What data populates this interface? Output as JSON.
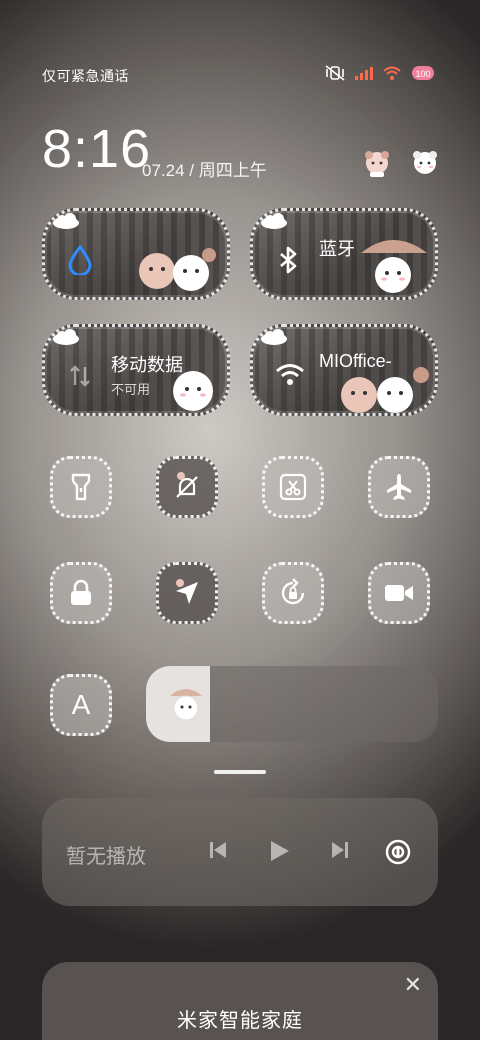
{
  "status_bar": {
    "carrier_text": "仅可紧急通话",
    "battery": "100"
  },
  "header": {
    "time": "8:16",
    "date": "07.24 / 周四上午"
  },
  "tiles": [
    {
      "id": "water",
      "title": "",
      "sub": "",
      "icon": "water-drop-icon",
      "accent": "#2f8cff"
    },
    {
      "id": "bluetooth",
      "title": "蓝牙",
      "sub": "",
      "icon": "bluetooth-icon"
    },
    {
      "id": "mobile-data",
      "title": "移动数据",
      "sub": "不可用",
      "icon": "mobile-data-icon"
    },
    {
      "id": "wifi",
      "title": "MIOffice-",
      "sub": "",
      "icon": "wifi-icon"
    }
  ],
  "toggles_row1": [
    "flashlight-icon",
    "mute-bell-icon",
    "screenshot-icon",
    "airplane-icon"
  ],
  "toggles_row2": [
    "lock-icon",
    "location-icon",
    "rotation-lock-icon",
    "video-record-icon"
  ],
  "auto_brightness_label": "A",
  "brightness": {
    "level": 0.22
  },
  "media": {
    "placeholder": "暂无播放"
  },
  "home_card": {
    "title": "米家智能家庭",
    "close": "✕"
  },
  "colors": {
    "accent_blue": "#2f8cff",
    "battery_pink": "#f07f9a",
    "signal_orange": "#ff6b4a"
  }
}
